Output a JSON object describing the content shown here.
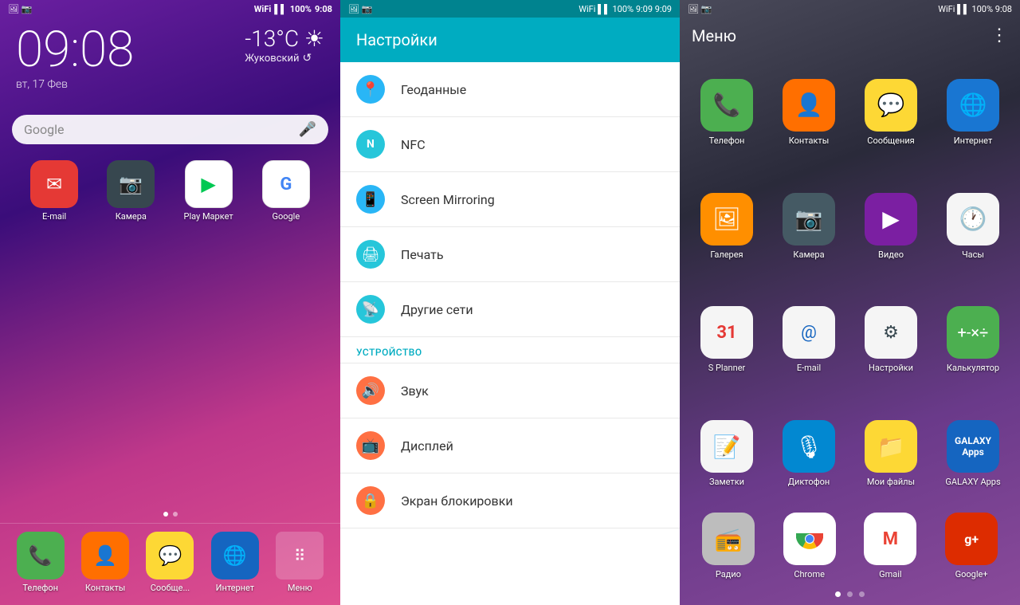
{
  "home": {
    "status_bar": {
      "time": "9:08",
      "battery": "100%",
      "signal": "▌▌▌▌",
      "wifi": "WiFi"
    },
    "time": "09:08",
    "date": "вт, 17 Фев",
    "weather": {
      "temp": "-13°C",
      "location": "Жуковский",
      "icon": "☀"
    },
    "search": {
      "placeholder": "Google"
    },
    "apps": [
      {
        "label": "E-mail",
        "icon": "✉",
        "bg": "ic-email"
      },
      {
        "label": "Камера",
        "icon": "📷",
        "bg": "ic-camera"
      },
      {
        "label": "Play\nМаркет",
        "icon": "▶",
        "bg": "ic-playstore"
      },
      {
        "label": "Google",
        "icon": "G",
        "bg": "ic-google"
      }
    ],
    "dock": [
      {
        "label": "Телефон",
        "icon": "📞",
        "bg": "ic-phone"
      },
      {
        "label": "Контакты",
        "icon": "👤",
        "bg": "ic-contacts"
      },
      {
        "label": "Сообще...",
        "icon": "💬",
        "bg": "ic-sms"
      },
      {
        "label": "Интернет",
        "icon": "🌐",
        "bg": "ic-internet"
      },
      {
        "label": "Меню",
        "icon": "⊞",
        "bg": "ic-menu"
      }
    ]
  },
  "settings": {
    "title": "Настройки",
    "status_bar": {
      "time": "9:09",
      "battery": "100%"
    },
    "items": [
      {
        "icon": "📍",
        "label": "Геоданные",
        "color": "si-blue"
      },
      {
        "icon": "N",
        "label": "NFC",
        "color": "si-teal"
      },
      {
        "icon": "📱",
        "label": "Screen Mirroring",
        "color": "si-blue"
      },
      {
        "icon": "🖨",
        "label": "Печать",
        "color": "si-teal"
      },
      {
        "icon": "📡",
        "label": "Другие сети",
        "color": "si-teal"
      }
    ],
    "section_device": "УСТРОЙСТВО",
    "device_items": [
      {
        "icon": "🔊",
        "label": "Звук",
        "color": "si-orange"
      },
      {
        "icon": "📺",
        "label": "Дисплей",
        "color": "si-orange"
      },
      {
        "icon": "🔒",
        "label": "Экран блокировки",
        "color": "si-orange"
      }
    ]
  },
  "drawer": {
    "title": "Меню",
    "status_bar": {
      "time": "9:08",
      "battery": "100%"
    },
    "apps": [
      {
        "label": "Телефон",
        "icon": "📞",
        "bg": "ic-phone-green"
      },
      {
        "label": "Контакты",
        "icon": "👤",
        "bg": "ic-contacts-orange"
      },
      {
        "label": "Сообщения",
        "icon": "💬",
        "bg": "ic-sms-yellow"
      },
      {
        "label": "Интернет",
        "icon": "🌐",
        "bg": "ic-internet-blue"
      },
      {
        "label": "Галерея",
        "icon": "🖼",
        "bg": "ic-gallery"
      },
      {
        "label": "Камера",
        "icon": "📷",
        "bg": "ic-camera-dark"
      },
      {
        "label": "Видео",
        "icon": "▶",
        "bg": "ic-video"
      },
      {
        "label": "Часы",
        "icon": "🕐",
        "bg": "ic-clock"
      },
      {
        "label": "S Planner",
        "icon": "31",
        "bg": "ic-splanner"
      },
      {
        "label": "E-mail",
        "icon": "@",
        "bg": "ic-emailapp"
      },
      {
        "label": "Настройки",
        "icon": "⚙",
        "bg": "ic-settingsapp"
      },
      {
        "label": "Калькулятор",
        "icon": "⊞",
        "bg": "ic-calc"
      },
      {
        "label": "Заметки",
        "icon": "📝",
        "bg": "ic-notes"
      },
      {
        "label": "Диктофон",
        "icon": "🎙",
        "bg": "ic-recorder"
      },
      {
        "label": "Мои файлы",
        "icon": "📁",
        "bg": "ic-myfiles"
      },
      {
        "label": "GALAXY Apps",
        "icon": "G",
        "bg": "ic-galaxyapps"
      },
      {
        "label": "Радио",
        "icon": "📻",
        "bg": "ic-radio"
      },
      {
        "label": "Chrome",
        "icon": "C",
        "bg": "ic-chrome"
      },
      {
        "label": "Gmail",
        "icon": "M",
        "bg": "ic-gmail"
      },
      {
        "label": "Google+",
        "icon": "g+",
        "bg": "ic-googleplus"
      }
    ],
    "dots": [
      0,
      1,
      2
    ],
    "active_dot": 0
  }
}
